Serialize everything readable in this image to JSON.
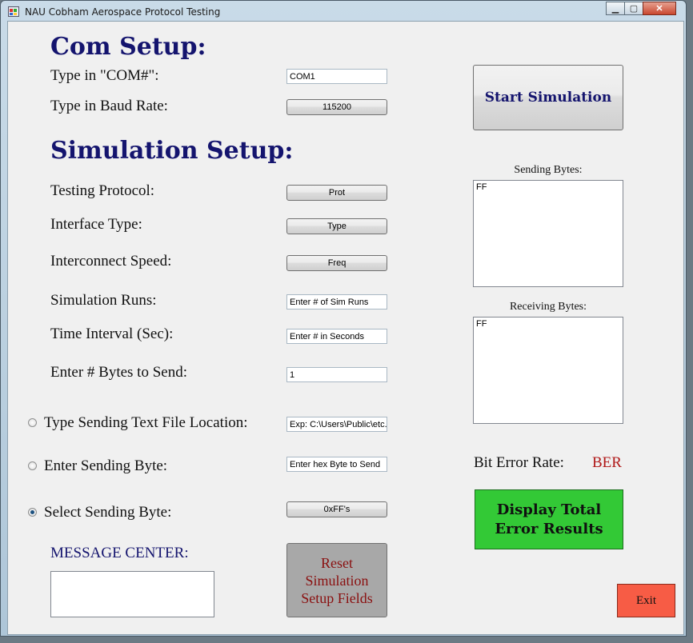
{
  "window": {
    "title": "NAU Cobham Aerospace Protocol Testing",
    "controls": {
      "minimize": "▁",
      "maximize": "▢",
      "close": "✕"
    }
  },
  "com_setup": {
    "heading": "Com Setup:",
    "com_label": "Type in \"COM#\":",
    "com_value": "COM1",
    "baud_label": "Type in Baud Rate:",
    "baud_value": "115200"
  },
  "simulation_setup": {
    "heading": "Simulation Setup:",
    "protocol_label": "Testing Protocol:",
    "protocol_button": "Prot",
    "interface_label": "Interface Type:",
    "interface_button": "Type",
    "speed_label": "Interconnect Speed:",
    "speed_button": "Freq",
    "runs_label": "Simulation Runs:",
    "runs_value": "Enter # of Sim Runs",
    "interval_label": "Time Interval (Sec):",
    "interval_value": "Enter # in Seconds",
    "bytes_label": "Enter # Bytes to Send:",
    "bytes_value": "1"
  },
  "sending_options": {
    "file_label": "Type Sending Text File Location:",
    "file_value": "Exp: C:\\Users\\Public\\etc.",
    "file_selected": false,
    "enter_byte_label": "Enter Sending Byte:",
    "enter_byte_value": "Enter hex Byte to Send",
    "enter_byte_selected": false,
    "select_byte_label": "Select Sending Byte:",
    "select_byte_button": "0xFF's",
    "select_byte_selected": true
  },
  "message_center": {
    "label": "MESSAGE CENTER:",
    "value": ""
  },
  "reset_button": "Reset Simulation Setup Fields",
  "start_button": "Start Simulation",
  "sending_bytes": {
    "caption": "Sending Bytes:",
    "content": "FF"
  },
  "receiving_bytes": {
    "caption": "Receiving Bytes:",
    "content": "FF"
  },
  "ber": {
    "label": "Bit Error Rate:",
    "value": "BER"
  },
  "display_button": "Display Total Error Results",
  "exit_button": "Exit",
  "colors": {
    "heading": "#14146e",
    "display_green": "#33c936",
    "exit_red": "#f75c45",
    "reset_gray": "#a8a8a8",
    "ber_red": "#b01818"
  }
}
